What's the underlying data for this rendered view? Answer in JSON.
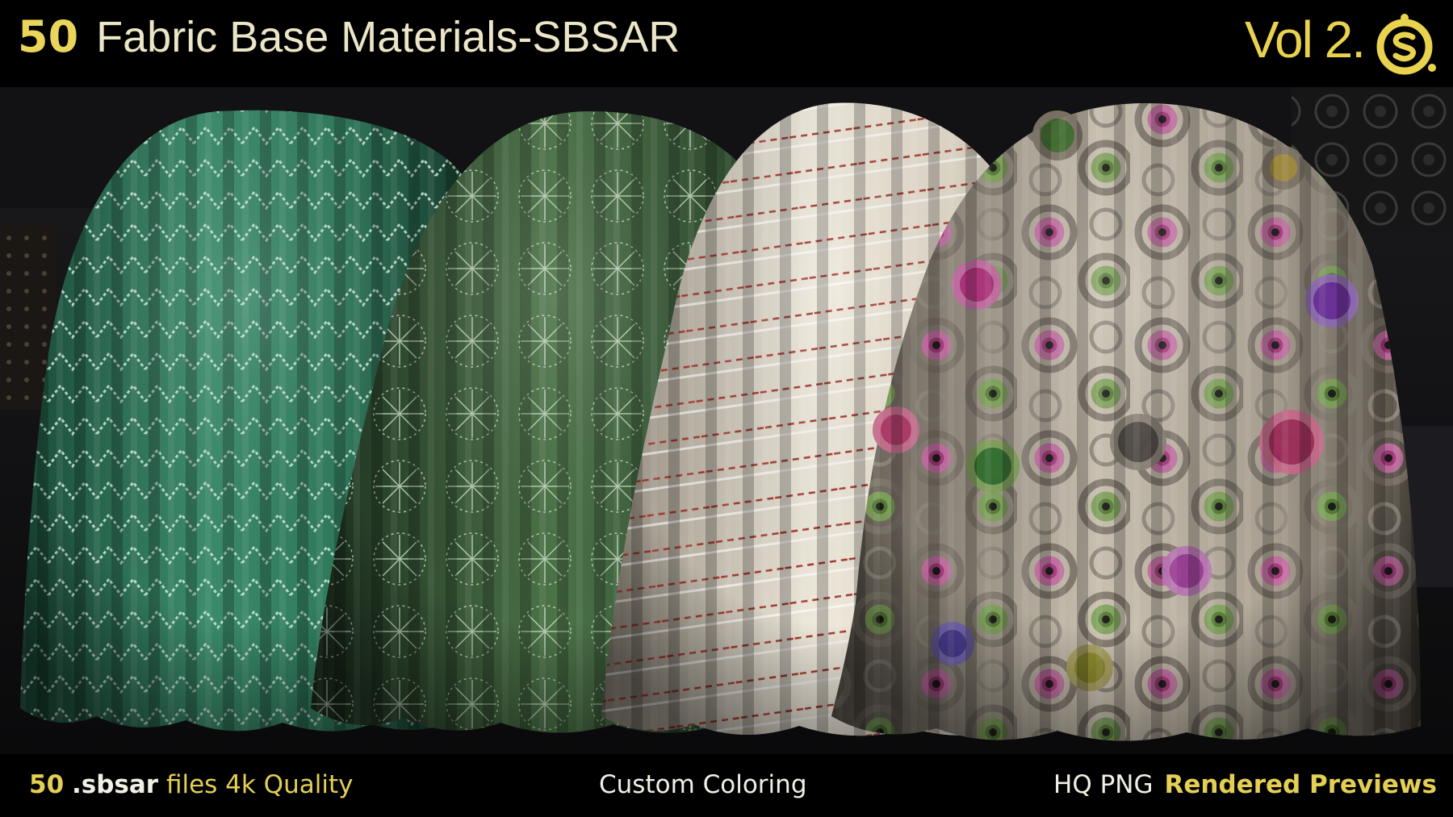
{
  "header": {
    "count": "50",
    "title": "Fabric Base Materials-SBSAR",
    "volume": "Vol 2."
  },
  "footer": {
    "left_count": "50",
    "left_ext": ".sbsar",
    "left_text": "files 4k Quality",
    "middle": "Custom Coloring",
    "right_plain": "HQ PNG",
    "right_highlight": "Rendered Previews"
  },
  "colors": {
    "accent_yellow": "#e8d55a",
    "title_cream": "#ece6c8",
    "background": "#000000"
  },
  "icons": [
    "substance-logo-icon"
  ]
}
